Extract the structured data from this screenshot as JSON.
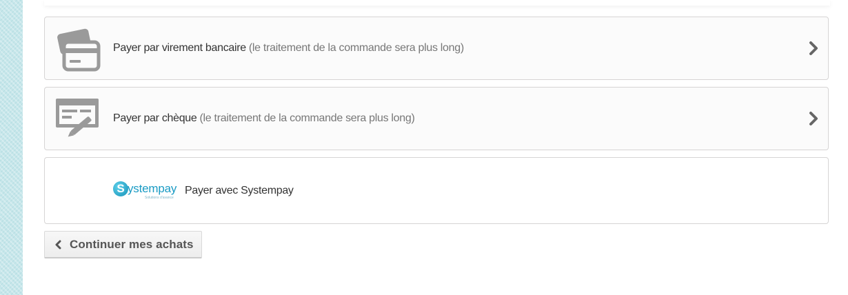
{
  "payment_options": [
    {
      "main": "Payer par virement bancaire",
      "note": "(le traitement de la commande sera plus long)",
      "icon": "bank-card-icon"
    },
    {
      "main": "Payer par chèque",
      "note": "(le traitement de la commande sera plus long)",
      "icon": "cheque-icon"
    },
    {
      "logo_letter": "S",
      "logo_word": "ystempay",
      "logo_tagline": "Solutions d'avance",
      "label": "Payer avec Systempay"
    }
  ],
  "continue_button": {
    "label": "Continuer mes achats",
    "icon": "chevron-left-icon"
  },
  "colors": {
    "side_pattern": "#c6e6ea",
    "icon_grey": "#999999",
    "systempay_blue": "#1a9bc4",
    "text_dark": "#333333",
    "text_muted": "#777777"
  }
}
